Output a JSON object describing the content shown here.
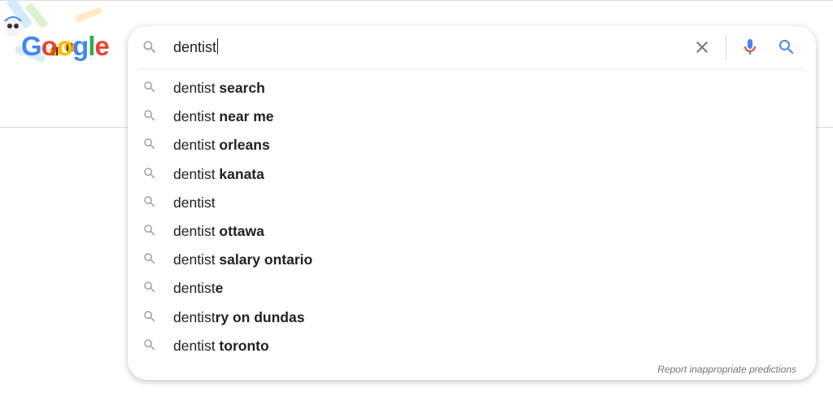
{
  "logo": {
    "letters": [
      "G",
      "o",
      "o",
      "g",
      "l",
      "e"
    ]
  },
  "search": {
    "query": "dentist"
  },
  "suggestions": [
    {
      "prefix": "dentist",
      "completion": " search"
    },
    {
      "prefix": "dentist",
      "completion": " near me"
    },
    {
      "prefix": "dentist",
      "completion": " orleans"
    },
    {
      "prefix": "dentist",
      "completion": " kanata"
    },
    {
      "prefix": "dentist",
      "completion": ""
    },
    {
      "prefix": "dentist",
      "completion": " ottawa"
    },
    {
      "prefix": "dentist",
      "completion": " salary ontario"
    },
    {
      "prefix": "dentist",
      "completion": "e"
    },
    {
      "prefix": "dentist",
      "completion": "ry on dundas"
    },
    {
      "prefix": "dentist",
      "completion": " toronto"
    }
  ],
  "report_link": "Report inappropriate predictions",
  "icons": {
    "search": "search-icon",
    "clear": "close-icon",
    "mic": "microphone-icon",
    "submit": "search-icon"
  },
  "colors": {
    "blue": "#4285f4",
    "red": "#ea4335",
    "yellow": "#fbbc05",
    "green": "#34a853",
    "text": "#202124",
    "muted": "#70757a"
  }
}
